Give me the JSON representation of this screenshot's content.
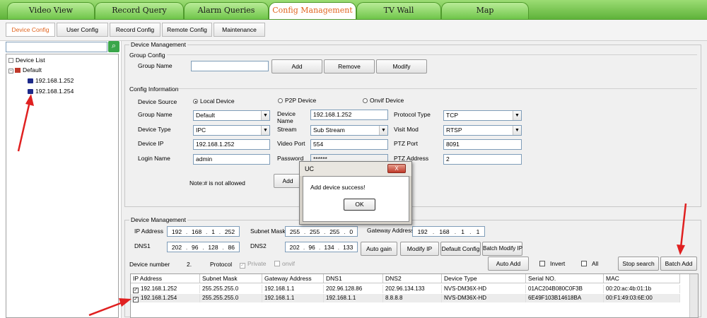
{
  "top_tabs": [
    "Video View",
    "Record Query",
    "Alarm Queries",
    "Config Management",
    "TV Wall",
    "Map"
  ],
  "active_top_tab": "Config Management",
  "sub_tabs": [
    "Device Config",
    "User Config",
    "Record Config",
    "Remote Config",
    "Maintenance"
  ],
  "active_sub_tab": "Device Config",
  "search": {
    "value": "",
    "icon": "search-icon"
  },
  "tree": {
    "root": "Device List",
    "group": "Default",
    "devices": [
      "192.168.1.252",
      "192.168.1.254"
    ]
  },
  "device_management": {
    "title": "Device Management",
    "group_config": {
      "title": "Group Config",
      "group_name_label": "Group Name",
      "group_name_value": "",
      "add": "Add",
      "remove": "Remove",
      "modify": "Modify"
    },
    "config_info": {
      "title": "Config Information",
      "device_source_label": "Device Source",
      "sources": [
        "Local Device",
        "P2P Device",
        "Onvif Device"
      ],
      "selected_source": "Local Device",
      "group_name_label": "Group Name",
      "group_name_value": "Default",
      "device_name_label": "Device Name",
      "device_name_value": "192.168.1.252",
      "protocol_type_label": "Protocol Type",
      "protocol_type_value": "TCP",
      "device_type_label": "Device Type",
      "device_type_value": "IPC",
      "stream_label": "Stream",
      "stream_value": "Sub Stream",
      "visit_mod_label": "Visit Mod",
      "visit_mod_value": "RTSP",
      "device_ip_label": "Device IP",
      "device_ip_value": "192.168.1.252",
      "video_port_label": "Video Port",
      "video_port_value": "554",
      "ptz_port_label": "PTZ Port",
      "ptz_port_value": "8091",
      "login_name_label": "Login Name",
      "login_name_value": "admin",
      "password_label": "Password",
      "password_value": "******",
      "ptz_address_label": "PTZ Address",
      "ptz_address_value": "2",
      "note": "Note:# is not allowed",
      "add": "Add"
    }
  },
  "lower": {
    "title": "Device Management",
    "ip_address_label": "IP Address",
    "ip_address": [
      "192",
      "168",
      "1",
      "252"
    ],
    "subnet_mask_label": "Subnet Mask",
    "subnet_mask": [
      "255",
      "255",
      "255",
      "0"
    ],
    "gateway_label": "Gateway Address",
    "gateway": [
      "192",
      "168",
      "1",
      "1"
    ],
    "dns1_label": "DNS1",
    "dns1": [
      "202",
      "96",
      "128",
      "86"
    ],
    "dns2_label": "DNS2",
    "dns2": [
      "202",
      "96",
      "134",
      "133"
    ],
    "auto_gain": "Auto gain",
    "modify_ip": "Modify IP",
    "default_config": "Default Config",
    "batch_modify_ip": "Batch Modify IP",
    "device_number_label": "Device number",
    "device_number": "2.",
    "protocol_label": "Protocol",
    "private": "Private",
    "onvif": "onvif",
    "auto_add": "Auto Add",
    "invert": "Invert",
    "all": "All",
    "stop_search": "Stop search",
    "batch_add": "Batch Add"
  },
  "table": {
    "columns": [
      "IP Address",
      "Subnet Mask",
      "Gateway Address",
      "DNS1",
      "DNS2",
      "Device Type",
      "Serial NO.",
      "MAC"
    ],
    "rows": [
      [
        "192.168.1.252",
        "255.255.255.0",
        "192.168.1.1",
        "202.96.128.86",
        "202.96.134.133",
        "NVS-DM36X-HD",
        "01AC204B080C0F3B",
        "00:20:ac:4b:01:1b"
      ],
      [
        "192.168.1.254",
        "255.255.255.0",
        "192.168.1.1",
        "192.168.1.1",
        "8.8.8.8",
        "NVS-DM36X-HD",
        "6E49F103B14618BA",
        "00:F1:49:03:6E:00"
      ]
    ]
  },
  "dialog": {
    "title": "UC",
    "message": "Add device success!",
    "ok": "OK",
    "close": "X"
  },
  "colors": {
    "accent": "#e0641e",
    "tab_green": "#6fc54a",
    "arrow_red": "#e02020"
  }
}
